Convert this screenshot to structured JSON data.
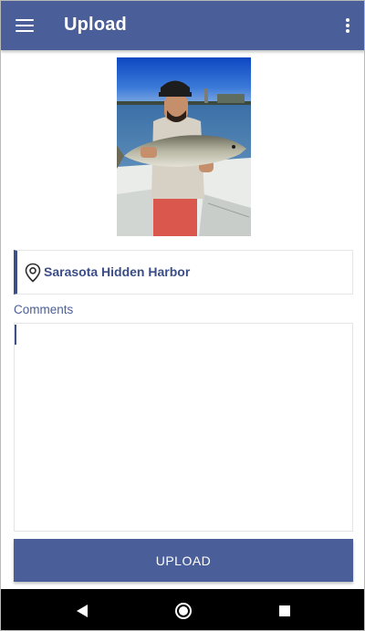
{
  "header": {
    "title": "Upload",
    "menu_icon": "hamburger-menu-icon",
    "overflow_icon": "more-vert-icon",
    "color": "#4a5f9a"
  },
  "photo": {
    "icon": "catch-photo"
  },
  "location": {
    "icon": "location-pin-icon",
    "name": "Sarasota Hidden Harbor",
    "accent": "#3e4f86"
  },
  "comments": {
    "label": "Comments",
    "value": ""
  },
  "actions": {
    "upload_label": "UPLOAD"
  },
  "navigation": {
    "back_icon": "back-triangle-icon",
    "home_icon": "home-circle-icon",
    "recent_icon": "recent-apps-square-icon"
  }
}
